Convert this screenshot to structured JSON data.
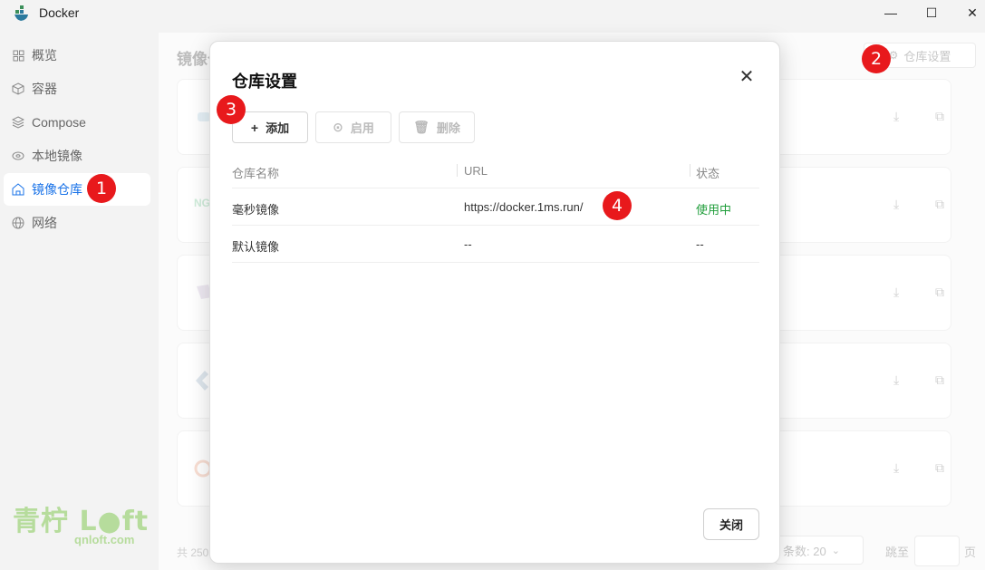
{
  "window": {
    "title": "Docker",
    "minimize": "—",
    "maximize": "☐",
    "close": "✕"
  },
  "sidebar": {
    "items": [
      {
        "label": "概览",
        "icon": "grid-icon"
      },
      {
        "label": "容器",
        "icon": "cube-icon"
      },
      {
        "label": "Compose",
        "icon": "layers-icon"
      },
      {
        "label": "本地镜像",
        "icon": "disk-icon"
      },
      {
        "label": "镜像仓库",
        "icon": "home-icon",
        "active": true
      },
      {
        "label": "网络",
        "icon": "globe-icon"
      }
    ],
    "watermark": {
      "big": "青柠 L●ft",
      "small": "qnloft.com"
    }
  },
  "main": {
    "title": "镜像仓",
    "repo_settings_button": "仓库设置",
    "card_thumb_text": "NG",
    "footer": {
      "total": "共 250",
      "page_size": "条数: 20",
      "jump_label": "跳至",
      "page_label": "页"
    }
  },
  "dialog": {
    "title": "仓库设置",
    "toolbar": {
      "add": "添加",
      "enable": "启用",
      "delete": "删除"
    },
    "columns": {
      "name": "仓库名称",
      "url": "URL",
      "status": "状态"
    },
    "rows": [
      {
        "name": "毫秒镜像",
        "url": "https://docker.1ms.run/",
        "status": "使用中"
      },
      {
        "name": "默认镜像",
        "url": "--",
        "status": "--"
      }
    ],
    "close_button": "关闭"
  },
  "markers": [
    "1",
    "2",
    "3",
    "4"
  ],
  "colors": {
    "accent": "#1a73e8",
    "status_active": "#1f9d3a",
    "marker": "#e8191c"
  }
}
